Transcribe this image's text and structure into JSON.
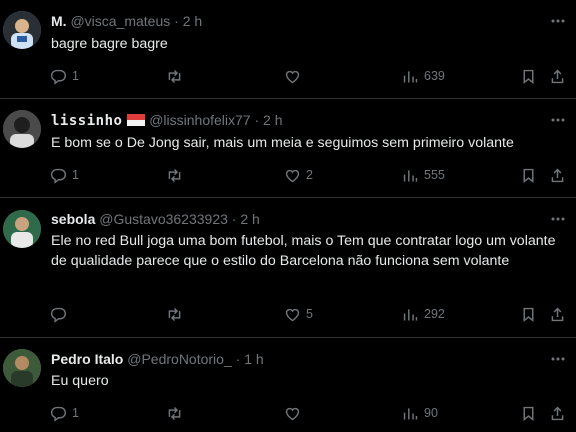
{
  "tweets": [
    {
      "name": "M.",
      "handle": "@visca_mateus",
      "time": "2 h",
      "text": "bagre bagre bagre",
      "replies": "1",
      "retweets": "",
      "likes": "",
      "views": "639",
      "avatar_color": "#5b8fc9"
    },
    {
      "name": "lissinho",
      "handle": "@lissinhofelix77",
      "time": "2 h",
      "text": "E bom se o De Jong sair, mais um meia e seguimos sem primeiro volante",
      "replies": "1",
      "retweets": "",
      "likes": "2",
      "views": "555",
      "avatar_color": "#6b6b6b"
    },
    {
      "name": "sebola",
      "handle": "@Gustavo36233923",
      "time": "2 h",
      "text": "Ele no red Bull joga uma bom futebol, mais o Tem que contratar logo um volante de qualidade parece que o estilo do Barcelona não funciona sem volante",
      "replies": "",
      "retweets": "",
      "likes": "5",
      "views": "292",
      "avatar_color": "#3a7f5c"
    },
    {
      "name": "Pedro Italo",
      "handle": "@PedroNotorio_",
      "time": "1 h",
      "text": "Eu quero",
      "replies": "1",
      "retweets": "",
      "likes": "",
      "views": "90",
      "avatar_color": "#7a6a4f"
    }
  ],
  "separator": "·",
  "colors": {
    "background": "#000000",
    "text": "#e7e9ea",
    "muted": "#71767b",
    "border": "#2f3336"
  },
  "icons": [
    "reply-icon",
    "retweet-icon",
    "like-icon",
    "views-icon",
    "bookmark-icon",
    "share-icon",
    "more-icon"
  ]
}
